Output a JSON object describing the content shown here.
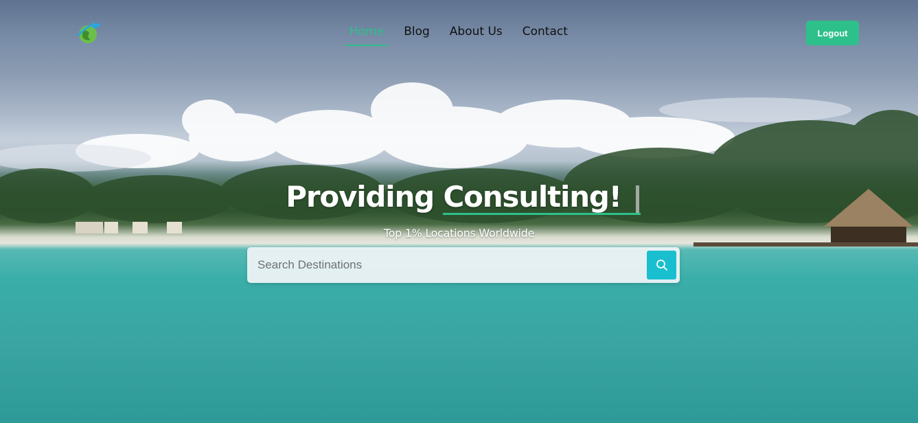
{
  "nav": {
    "logo_icon": "travel-globe-plane-icon",
    "links": [
      {
        "label": "Home",
        "active": true
      },
      {
        "label": "Blog",
        "active": false
      },
      {
        "label": "About Us",
        "active": false
      },
      {
        "label": "Contact",
        "active": false
      }
    ],
    "logout_label": "Logout"
  },
  "hero": {
    "headline_prefix": "Providing",
    "headline_typed": "Consulting!",
    "subtitle": "Top 1% Locations Worldwide"
  },
  "search": {
    "placeholder": "Search Destinations",
    "button_icon": "search-icon"
  },
  "colors": {
    "accent": "#2ec08b",
    "search_button": "#19bfcf",
    "text_dark": "#111111",
    "text_light": "#ffffff"
  }
}
